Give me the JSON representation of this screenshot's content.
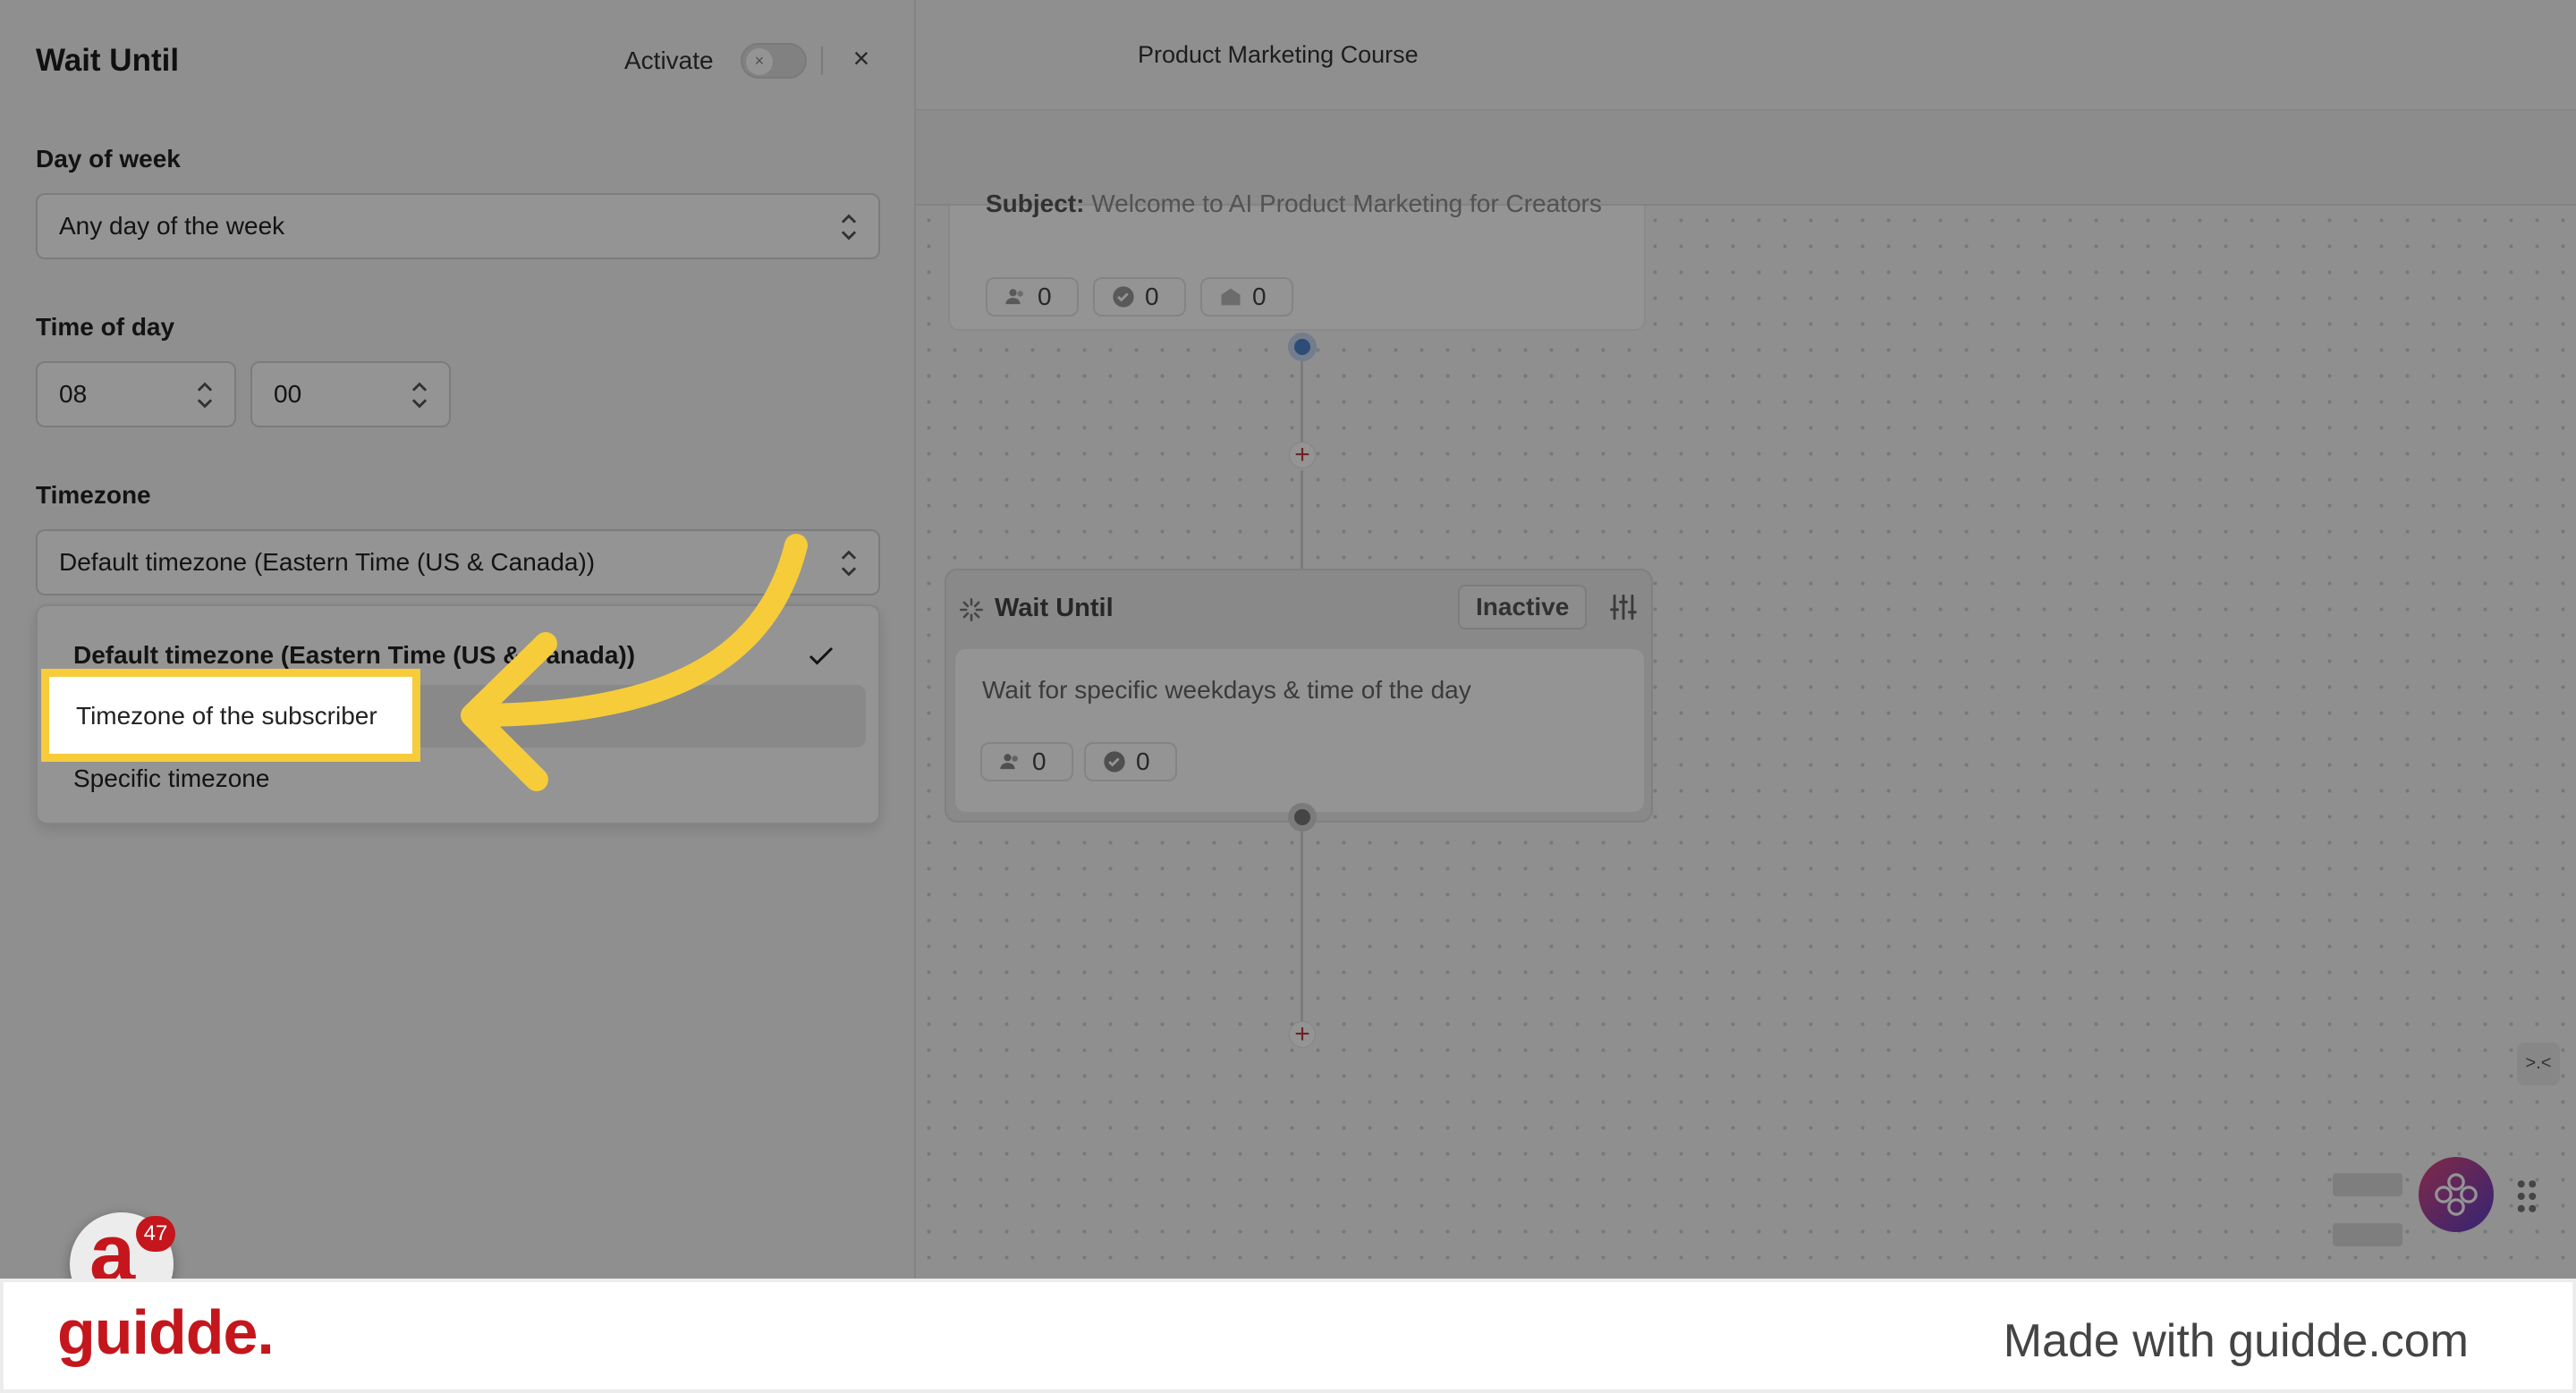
{
  "canvas": {
    "header_title": "Product Marketing Course",
    "email_card": {
      "subject_label": "Subject:",
      "subject_text": "Welcome to AI Product Marketing for Creators",
      "stats": [
        "0",
        "0",
        "0"
      ]
    },
    "wait_card": {
      "title": "Wait Until",
      "status": "Inactive",
      "description": "Wait for specific weekdays & time of the day",
      "stats": [
        "0",
        "0"
      ]
    },
    "collapse_label": ">.<"
  },
  "panel": {
    "title": "Wait Until",
    "activate_label": "Activate",
    "close_label": "×",
    "day_of_week": {
      "label": "Day of week",
      "value": "Any day of the week"
    },
    "time_of_day": {
      "label": "Time of day",
      "hour": "08",
      "minute": "00"
    },
    "timezone": {
      "label": "Timezone",
      "value": "Default timezone (Eastern Time (US & Canada))",
      "options": [
        {
          "label": "Default timezone (Eastern Time (US & Canada))",
          "selected": true
        },
        {
          "label": "Timezone of the subscriber",
          "selected": false
        },
        {
          "label": "Specific timezone",
          "selected": false
        }
      ]
    }
  },
  "app_avatar": {
    "letter": "a",
    "badge": "47"
  },
  "footer": {
    "logo": "guidde.",
    "tagline": "Made with guidde.com"
  },
  "colors": {
    "highlight": "#f6cc3a",
    "brand_red": "#c4161c",
    "node_blue": "#4f83cf"
  }
}
